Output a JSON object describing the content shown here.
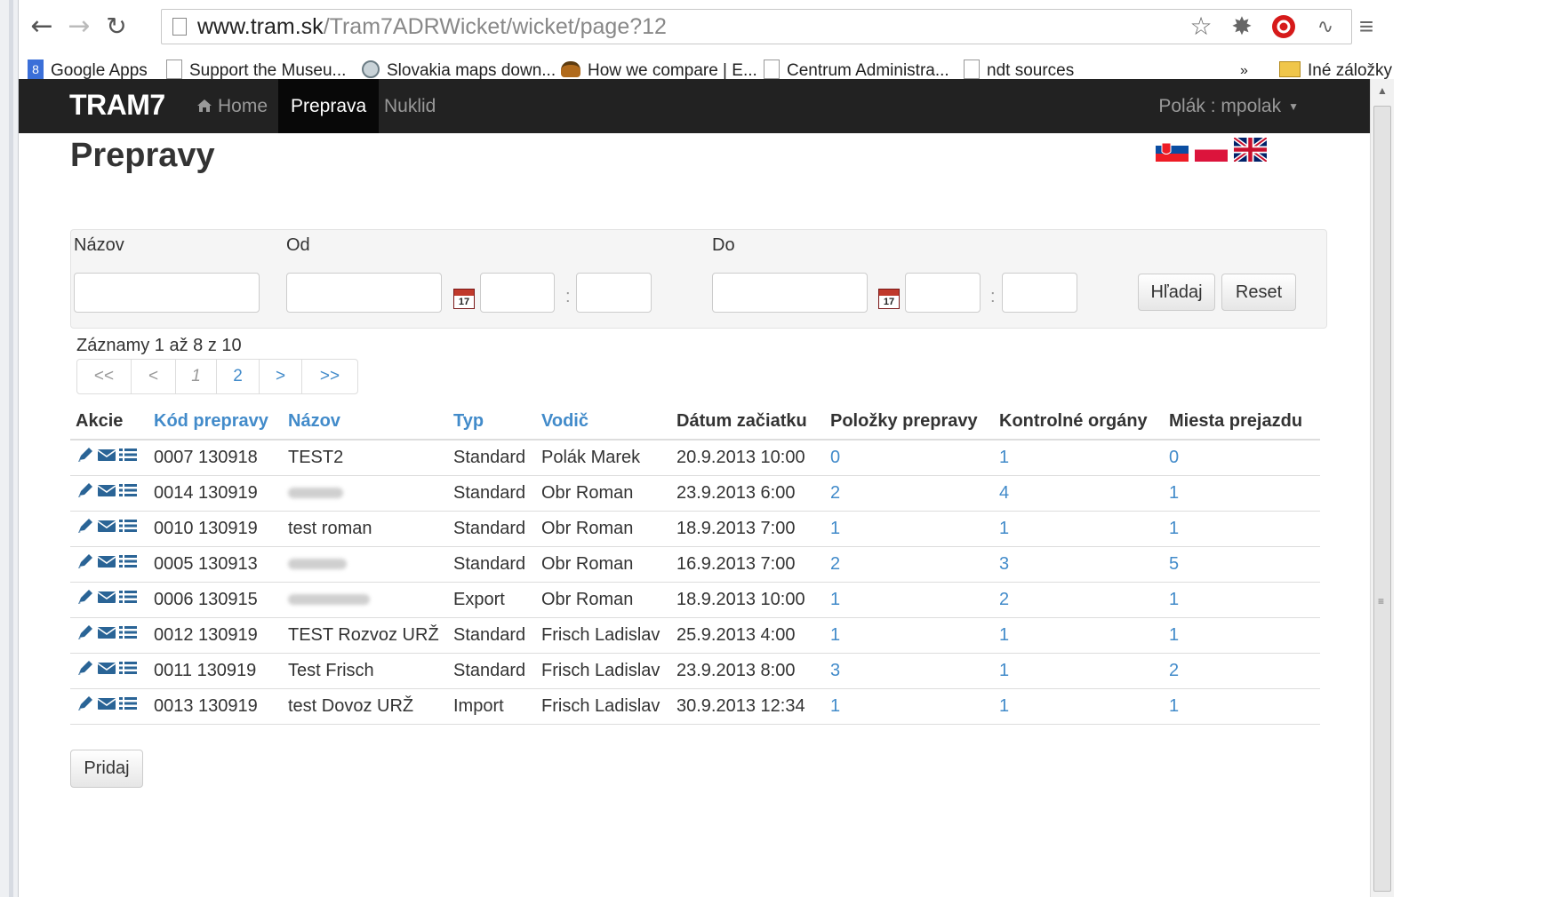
{
  "browser": {
    "nav": {
      "back_icon": "arrow-left-icon",
      "forward_icon": "arrow-right-icon",
      "reload_icon": "reload-icon"
    },
    "url": {
      "host": "www.tram.sk",
      "path": "/Tram7ADRWicket/wicket/page?12"
    },
    "toolbar_icons": [
      "star-icon",
      "extension-icon",
      "adblock-icon",
      "extension-icon",
      "menu-icon"
    ],
    "bookmarks": [
      {
        "label": "Google Apps",
        "icon": "google-apps-icon"
      },
      {
        "label": "Support the Museu...",
        "icon": "page-icon"
      },
      {
        "label": "Slovakia maps down...",
        "icon": "globe-icon"
      },
      {
        "label": "How we compare | E...",
        "icon": "burger-icon"
      },
      {
        "label": "Centrum Administra...",
        "icon": "page-icon"
      },
      {
        "label": "ndt sources",
        "icon": "page-icon"
      }
    ],
    "bookmarks_overflow": "»",
    "other_bookmarks": "Iné záložky"
  },
  "navbar": {
    "brand": "TRAM7",
    "items": [
      {
        "label": "Home",
        "icon": "home-icon"
      },
      {
        "label": "Preprava",
        "active": true
      },
      {
        "label": "Nuklid"
      }
    ],
    "user": "Polák : mpolak"
  },
  "page": {
    "title": "Prepravy",
    "languages": [
      "sk",
      "pl",
      "en"
    ]
  },
  "filter": {
    "name_label": "Názov",
    "from_label": "Od",
    "to_label": "Do",
    "time_separator": ":",
    "name_value": "",
    "calendar_day": "17",
    "search_button": "Hľadaj",
    "reset_button": "Reset"
  },
  "records_info": "Záznamy 1 až 8 z 10",
  "pagination": [
    "<<",
    "<",
    "1",
    "2",
    ">",
    ">>"
  ],
  "table": {
    "headers": [
      "Akcie",
      "Kód prepravy",
      "Názov",
      "Typ",
      "Vodič",
      "Dátum začiatku",
      "Položky prepravy",
      "Kontrolné orgány",
      "Miesta prejazdu"
    ],
    "sortable": [
      false,
      true,
      true,
      true,
      true,
      false,
      false,
      false,
      false
    ],
    "rows": [
      {
        "code": "0007 130918",
        "name": "TEST2",
        "type": "Standard",
        "driver": "Polák Marek",
        "start": "20.9.2013 10:00",
        "items": "0",
        "controls": "1",
        "places": "0"
      },
      {
        "code": "0014 130919",
        "name": "",
        "type": "Standard",
        "driver": "Obr Roman",
        "start": "23.9.2013 6:00",
        "items": "2",
        "controls": "4",
        "places": "1"
      },
      {
        "code": "0010 130919",
        "name": "test roman",
        "type": "Standard",
        "driver": "Obr Roman",
        "start": "18.9.2013 7:00",
        "items": "1",
        "controls": "1",
        "places": "1"
      },
      {
        "code": "0005 130913",
        "name": "",
        "type": "Standard",
        "driver": "Obr Roman",
        "start": "16.9.2013 7:00",
        "items": "2",
        "controls": "3",
        "places": "5"
      },
      {
        "code": "0006 130915",
        "name": "",
        "type": "Export",
        "driver": "Obr Roman",
        "start": "18.9.2013 10:00",
        "items": "1",
        "controls": "2",
        "places": "1"
      },
      {
        "code": "0012 130919",
        "name": "TEST Rozvoz URŽ",
        "type": "Standard",
        "driver": "Frisch Ladislav",
        "start": "25.9.2013 4:00",
        "items": "1",
        "controls": "1",
        "places": "1"
      },
      {
        "code": "0011 130919",
        "name": "Test Frisch",
        "type": "Standard",
        "driver": "Frisch Ladislav",
        "start": "23.9.2013 8:00",
        "items": "3",
        "controls": "1",
        "places": "2"
      },
      {
        "code": "0013 130919",
        "name": "test Dovoz URŽ",
        "type": "Import",
        "driver": "Frisch Ladislav",
        "start": "30.9.2013 12:34",
        "items": "1",
        "controls": "1",
        "places": "1"
      }
    ]
  },
  "add_button": "Pridaj",
  "colors": {
    "navbar_bg": "#222222",
    "link": "#428bca",
    "action_icon": "#2a6496"
  }
}
